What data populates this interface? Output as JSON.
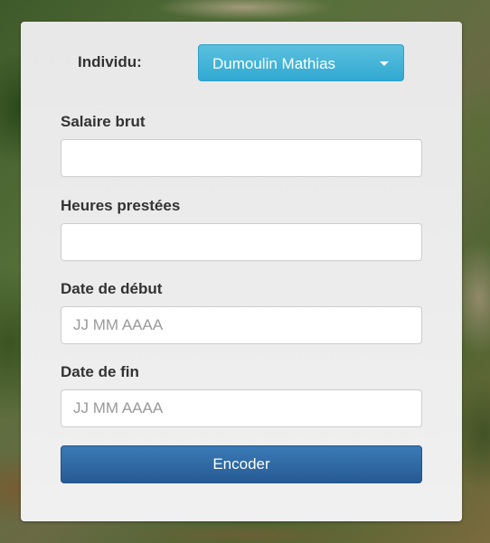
{
  "form": {
    "individu_label": "Individu:",
    "individu_selected": "Dumoulin Mathias",
    "fields": [
      {
        "label": "Salaire brut",
        "value": "",
        "placeholder": ""
      },
      {
        "label": "Heures prestées",
        "value": "",
        "placeholder": ""
      },
      {
        "label": "Date de début",
        "value": "",
        "placeholder": "JJ MM AAAA"
      },
      {
        "label": "Date de fin",
        "value": "",
        "placeholder": "JJ MM AAAA"
      }
    ],
    "submit_label": "Encoder"
  },
  "colors": {
    "dropdown": "#39b3d7",
    "submit": "#2e6da4",
    "panel": "#ececec"
  },
  "icons": {
    "dropdown_caret": "caret-down-icon"
  }
}
